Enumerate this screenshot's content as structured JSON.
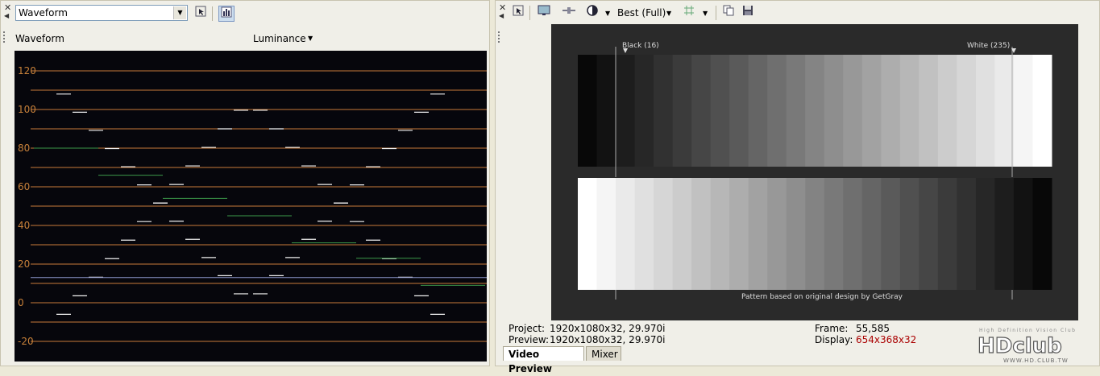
{
  "left_panel": {
    "scope_selector": {
      "value": "Waveform"
    },
    "scope_title": "Waveform",
    "scope_mode": "Luminance",
    "y_axis_ticks": [
      "120",
      "100",
      "80",
      "60",
      "40",
      "20",
      "0",
      "-20"
    ]
  },
  "right_panel": {
    "quality_selector": {
      "value": "Best (Full)"
    },
    "preview": {
      "black_marker": "Black (16)",
      "white_marker": "White (235)",
      "caption": "Pattern based on original design by GetGray"
    },
    "status": {
      "project_label": "Project:",
      "project_value": "1920x1080x32, 29.970i",
      "preview_label": "Preview:",
      "preview_value": "1920x1080x32, 29.970i",
      "frame_label": "Frame:",
      "frame_value": "55,585",
      "display_label": "Display:",
      "display_value": "654x368x32"
    },
    "tabs": [
      {
        "label": "Video Preview",
        "active": true
      },
      {
        "label": "Mixer",
        "active": false
      }
    ]
  },
  "watermark": {
    "small_text": "High Definition Vision Club",
    "brand": "HDclub",
    "url": "WWW.HD.CLUB.TW"
  },
  "colors": {
    "scope_gridline": "#c87a3a",
    "scope_label": "#c8813a",
    "display_value": "#a00000"
  }
}
